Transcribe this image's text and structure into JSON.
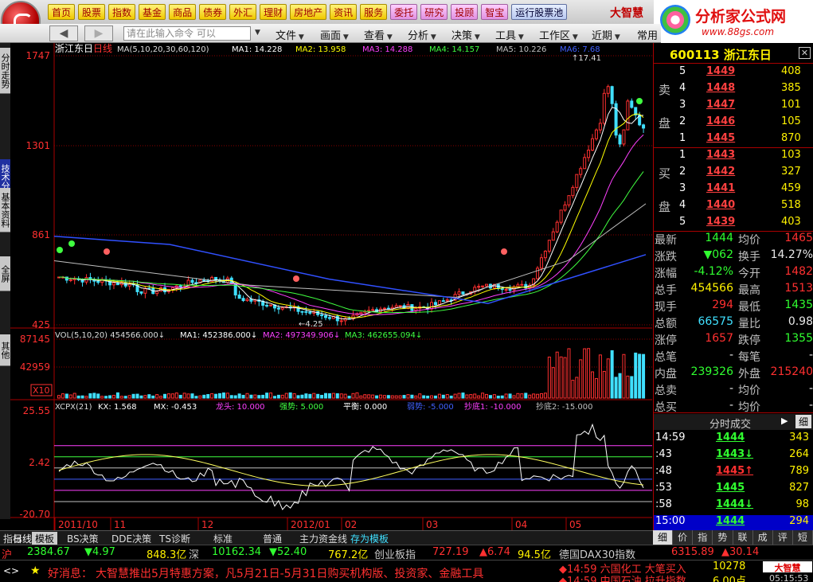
{
  "toolbar": {
    "main_buttons": [
      "首页",
      "股票",
      "指数",
      "基金",
      "商品",
      "债券",
      "外汇",
      "理财",
      "房地产",
      "资讯",
      "服务"
    ],
    "pink_buttons": [
      "委托",
      "研究",
      "投顾",
      "智宝"
    ],
    "pool_button": "运行股票池",
    "brand_partial": "大智慧"
  },
  "brand": {
    "name": "分析家公式网",
    "url": "www.88gs.com"
  },
  "secondbar": {
    "command_placeholder": "请在此输入命令  可以",
    "menus": [
      "文件",
      "画面",
      "查看",
      "分析",
      "决策",
      "工具",
      "工作区",
      "近期",
      "常用"
    ]
  },
  "left_tabs": [
    "分时走势",
    "技术分析",
    "基本资料",
    "全屏",
    "其他"
  ],
  "chart": {
    "title": "浙江东日",
    "period": "日线",
    "ma_label": "MA(5,10,20,30,60,120)",
    "ma_values": [
      {
        "name": "MA1",
        "value": "14.228",
        "color": "#ffffff"
      },
      {
        "name": "MA2",
        "value": "13.958",
        "color": "#ffff00"
      },
      {
        "name": "MA3",
        "value": "14.288",
        "color": "#ff40ff"
      },
      {
        "name": "MA4",
        "value": "14.157",
        "color": "#40ff40"
      },
      {
        "name": "MA5",
        "value": "10.226",
        "color": "#c0c0c0"
      },
      {
        "name": "MA6",
        "value": "7.68",
        "color": "#4060ff"
      }
    ],
    "price_axis": [
      "1747",
      "1301",
      "861",
      "425"
    ],
    "high_marker": "17.41",
    "low_marker": "4.25",
    "vol_label": "VOL(5,10,20)",
    "vol_value": "454566.000",
    "vol_ma": [
      {
        "name": "MA1",
        "value": "452386.000",
        "color": "#ffffff"
      },
      {
        "name": "MA2",
        "value": "497349.906",
        "color": "#ff40ff"
      },
      {
        "name": "MA3",
        "value": "462655.094",
        "color": "#40ff40"
      }
    ],
    "vol_axis": [
      "87145",
      "42959"
    ],
    "vol_unit": "X10",
    "ind_label": "XCPX(21)",
    "ind_values": [
      {
        "name": "KX",
        "value": "1.568",
        "color": "#ffffff"
      },
      {
        "name": "MX",
        "value": "-0.453",
        "color": "#ffffff"
      },
      {
        "name": "龙头",
        "value": "10.000",
        "color": "#ff40ff"
      },
      {
        "name": "强势",
        "value": "5.000",
        "color": "#40ff40"
      },
      {
        "name": "平衡",
        "value": "0.000",
        "color": "#ffffff"
      },
      {
        "name": "弱势",
        "value": "-5.000",
        "color": "#4060ff"
      },
      {
        "name": "抄底1",
        "value": "-10.000",
        "color": "#ff40ff"
      },
      {
        "name": "抄底2",
        "value": "-15.000",
        "color": "#c0c0c0"
      }
    ],
    "ind_axis": [
      "25.55",
      "2.42",
      "-20.70"
    ],
    "date_axis": [
      "2011/10",
      "11",
      "12",
      "2012/01",
      "02",
      "03",
      "04",
      "05"
    ]
  },
  "quote": {
    "code": "600113",
    "name": "浙江东日",
    "sell_label": "卖盘",
    "buy_label": "买盘",
    "asks": [
      {
        "n": "5",
        "price": "1449",
        "vol": "408"
      },
      {
        "n": "4",
        "price": "1448",
        "vol": "385"
      },
      {
        "n": "3",
        "price": "1447",
        "vol": "101"
      },
      {
        "n": "2",
        "price": "1446",
        "vol": "105"
      },
      {
        "n": "1",
        "price": "1445",
        "vol": "870"
      }
    ],
    "bids": [
      {
        "n": "1",
        "price": "1443",
        "vol": "103"
      },
      {
        "n": "2",
        "price": "1442",
        "vol": "327"
      },
      {
        "n": "3",
        "price": "1441",
        "vol": "459"
      },
      {
        "n": "4",
        "price": "1440",
        "vol": "518"
      },
      {
        "n": "5",
        "price": "1439",
        "vol": "403"
      }
    ],
    "stats": [
      {
        "k": "最新",
        "v": "1444",
        "vc": "grn",
        "k2": "均价",
        "v2": "1465",
        "v2c": "red"
      },
      {
        "k": "涨跌",
        "v": "▼062",
        "vc": "grn",
        "k2": "换手",
        "v2": "14.27%",
        "v2c": "wht"
      },
      {
        "k": "涨幅",
        "v": "-4.12%",
        "vc": "grn",
        "k2": "今开",
        "v2": "1482",
        "v2c": "red"
      },
      {
        "k": "总手",
        "v": "454566",
        "vc": "yel",
        "k2": "最高",
        "v2": "1513",
        "v2c": "red"
      },
      {
        "k": "现手",
        "v": "294",
        "vc": "red",
        "k2": "最低",
        "v2": "1435",
        "v2c": "grn"
      },
      {
        "k": "总额",
        "v": "66575",
        "vc": "cyan",
        "k2": "量比",
        "v2": "0.98",
        "v2c": "wht"
      },
      {
        "k": "涨停",
        "v": "1657",
        "vc": "red",
        "k2": "跌停",
        "v2": "1355",
        "v2c": "grn"
      },
      {
        "k": "总笔",
        "v": "-",
        "vc": "wht",
        "k2": "每笔",
        "v2": "-",
        "v2c": "wht"
      },
      {
        "k": "内盘",
        "v": "239326",
        "vc": "grn",
        "k2": "外盘",
        "v2": "215240",
        "v2c": "red"
      },
      {
        "k": "总卖",
        "v": "-",
        "vc": "wht",
        "k2": "均价",
        "v2": "-",
        "v2c": "wht"
      },
      {
        "k": "总买",
        "v": "-",
        "vc": "wht",
        "k2": "均价",
        "v2": "-",
        "v2c": "wht"
      }
    ],
    "ticks_title": "分时成交",
    "ticks_button": "细",
    "ticks": [
      {
        "t": "14:59",
        "p": "1444",
        "pc": "grn",
        "v": "343"
      },
      {
        "t": ":43",
        "p": "1443↓",
        "pc": "grn",
        "v": "264"
      },
      {
        "t": ":48",
        "p": "1445↑",
        "pc": "red",
        "v": "789"
      },
      {
        "t": ":53",
        "p": "1445",
        "pc": "grn",
        "v": "827"
      },
      {
        "t": ":58",
        "p": "1444↓",
        "pc": "grn",
        "v": "98"
      },
      {
        "t": "15:00",
        "p": "1444",
        "pc": "grn",
        "v": "294"
      }
    ],
    "bottom_tabs": [
      "细",
      "价",
      "指",
      "势",
      "联",
      "成",
      "评",
      "短"
    ]
  },
  "bottom_tabs": [
    "指标",
    "模板",
    "BS决策",
    "DDE决策",
    "TS诊断",
    "标准",
    "普通",
    "主力资金线",
    "存为模板"
  ],
  "bottom_tabs_prefix": "日线",
  "index_bar": {
    "sh_label": "沪",
    "sh_value": "2384.67",
    "sh_change": "▼4.97",
    "sh_amount": "848.3亿",
    "sz_label": "深",
    "sz_value": "10162.34",
    "sz_change": "▼52.40",
    "sz_amount": "767.2亿",
    "cy_label": "创业板指",
    "cy_value": "727.19",
    "cy_change": "▲6.74",
    "cy_amount": "94.5亿",
    "dax_label": "德国DAX30指数",
    "dax_value": "6315.89",
    "dax_change": "▲30.14"
  },
  "news": {
    "prefix": "好消息：",
    "text": "大智慧推出5月特惠方案，凡5月21日-5月31日购买机构版、投资家、金融工具",
    "alert1": "◆14:59 六国化工 大笔买入",
    "alert1_val": "10278",
    "alert2": "◆14:59 中国石油 拉升指数",
    "alert2_val": "6.00点",
    "time": "05:15:53",
    "logo": "大智慧"
  }
}
